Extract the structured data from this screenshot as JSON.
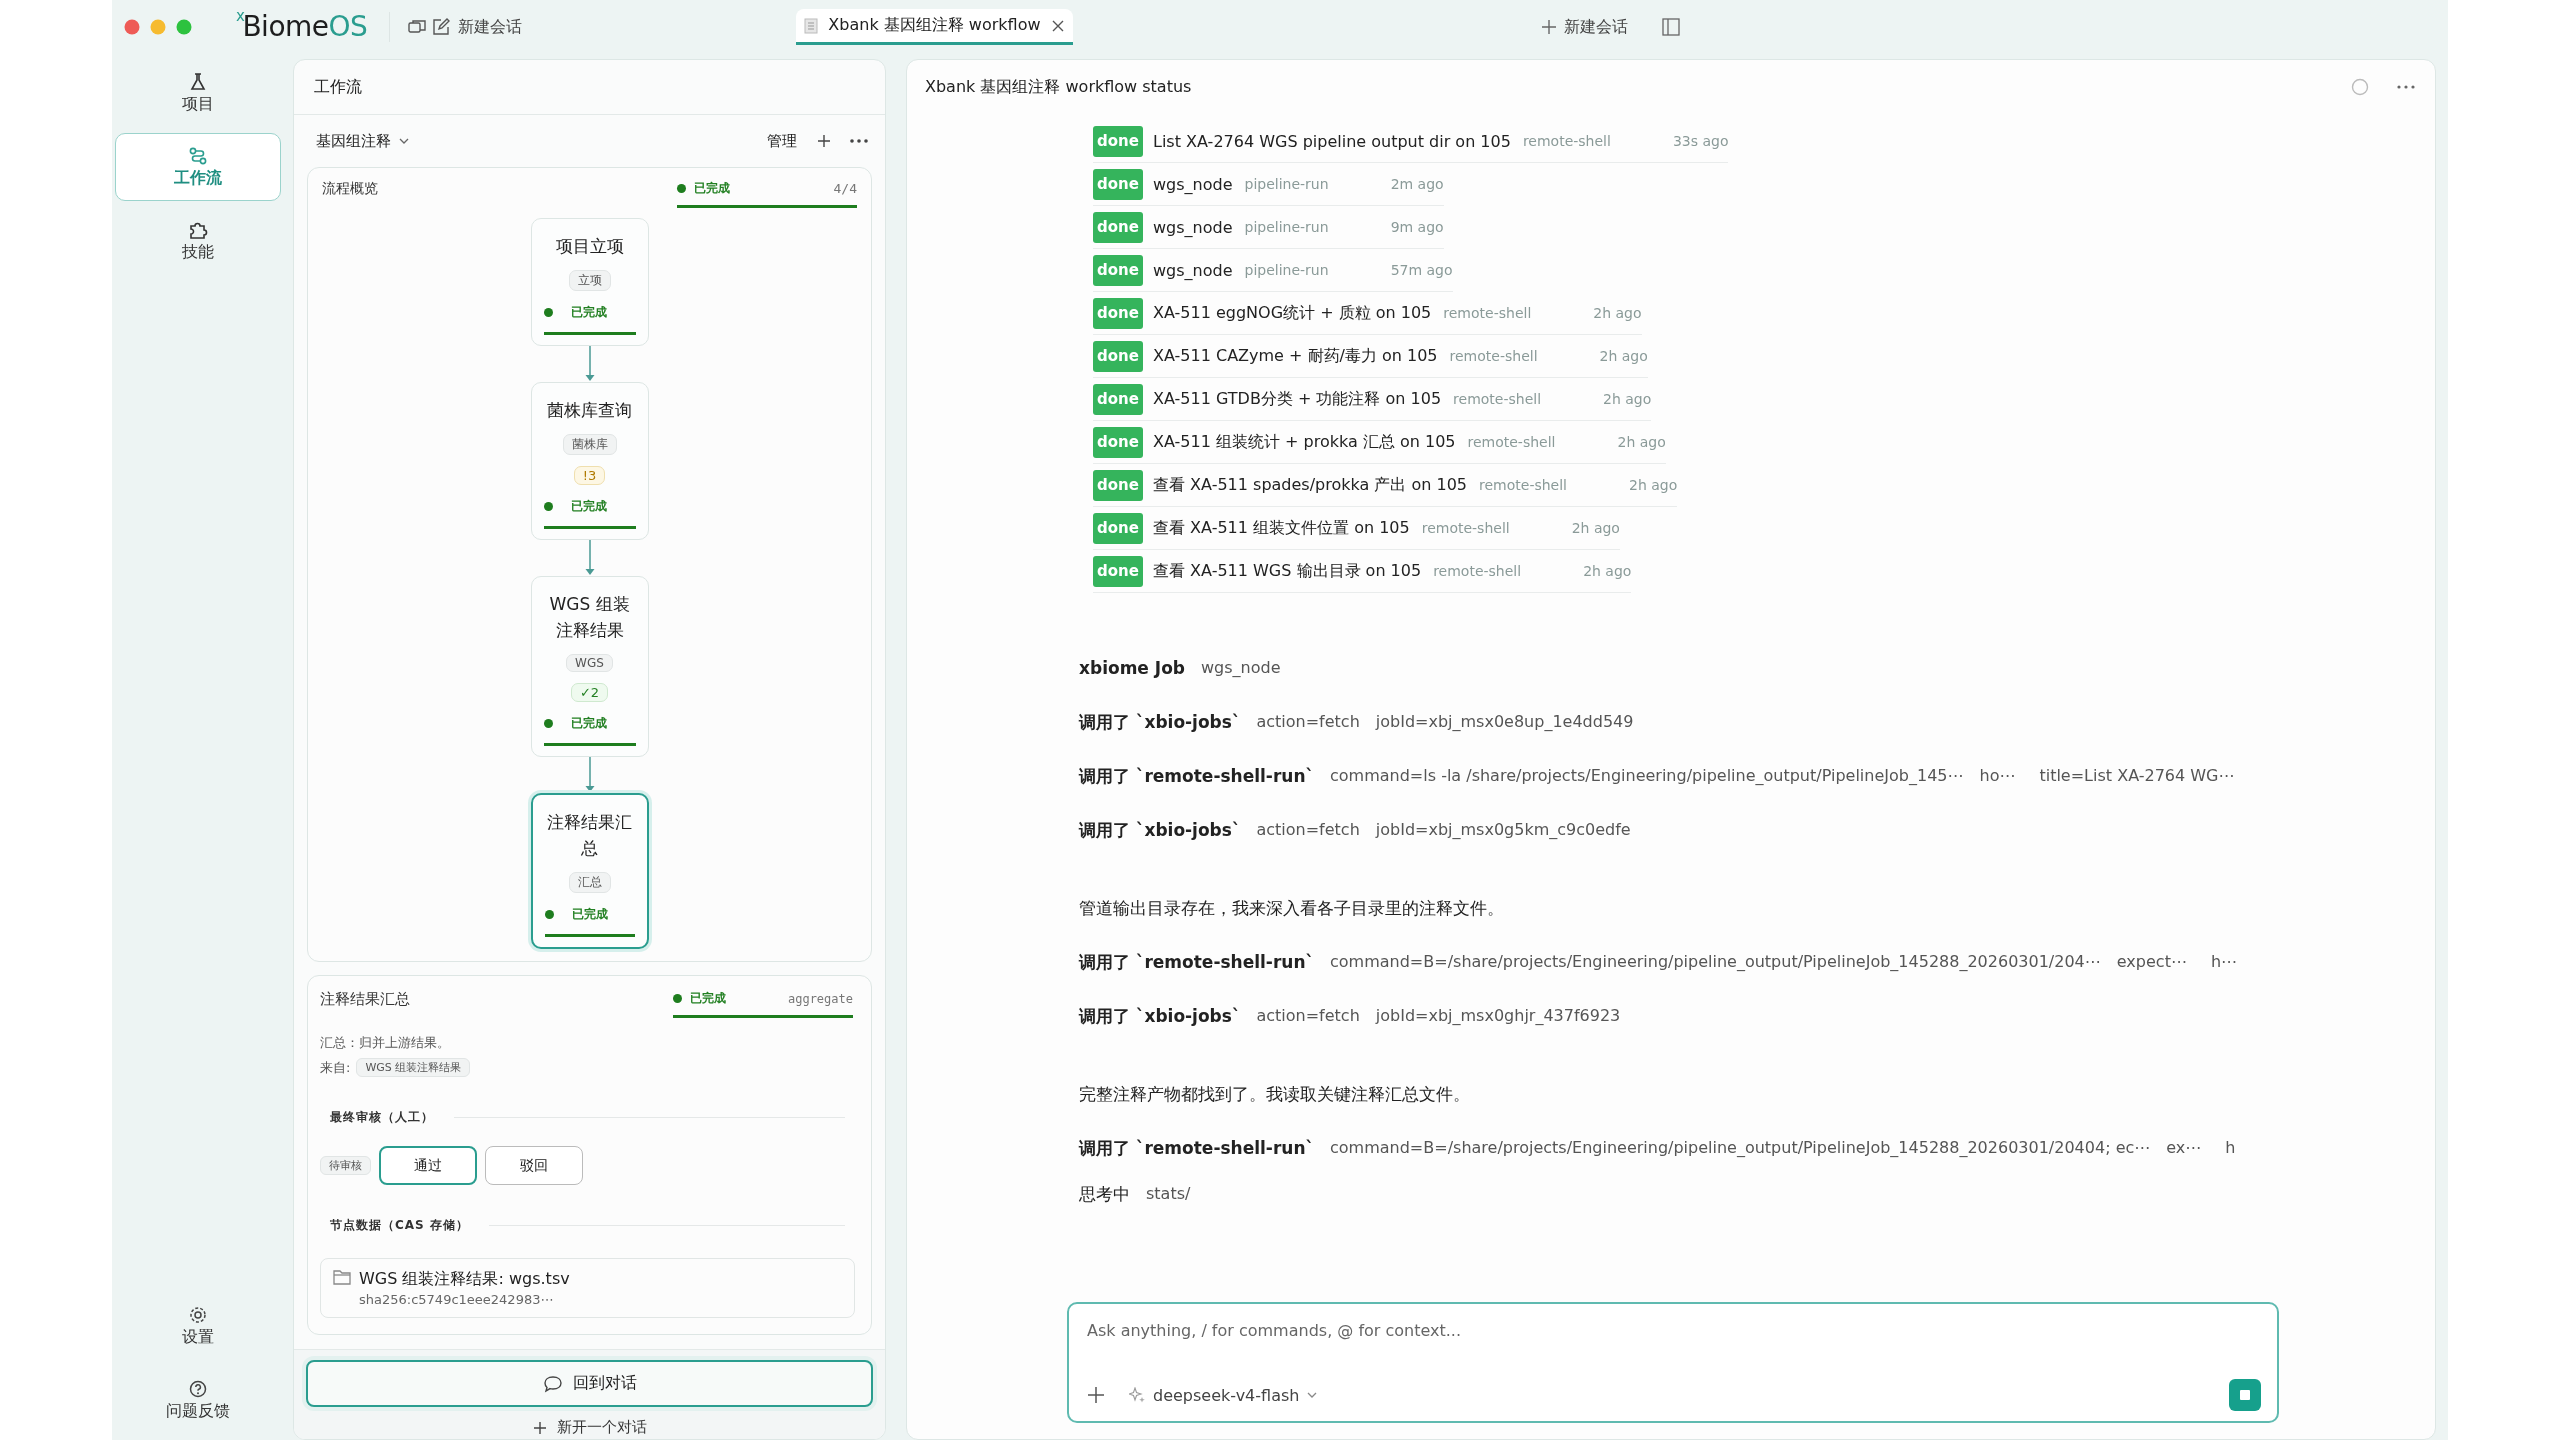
{
  "titlebar": {
    "logo": {
      "main": "Biome",
      "accent": "OS",
      "mark": "x"
    },
    "new_chat": "新建会话",
    "tabs": [
      {
        "label": "Xbank 基因组注释 workflow",
        "selected": true
      }
    ],
    "right_new_chat": "新建会话"
  },
  "nav": {
    "items": [
      {
        "kind": "project",
        "label": "项目",
        "selected": false
      },
      {
        "kind": "workflow",
        "label": "工作流",
        "selected": true
      },
      {
        "kind": "skills",
        "label": "技能",
        "selected": false
      }
    ],
    "bottom": [
      {
        "kind": "settings",
        "label": "设置"
      },
      {
        "kind": "feedback",
        "label": "问题反馈"
      }
    ]
  },
  "workflow": {
    "title": "工作流",
    "selector": "基因组注释",
    "manage": "管理",
    "overview": {
      "title": "流程概览",
      "status": "已完成",
      "count": "4/4",
      "level": 1,
      "nodes": [
        {
          "title": "项目立项",
          "tag": "立项",
          "status": "已完成",
          "level": 1,
          "selected": false
        },
        {
          "title": "菌株库查询",
          "tag": "菌株库",
          "badge": {
            "kind": "warning",
            "text": "!3"
          },
          "status": "已完成",
          "level": 1,
          "selected": false
        },
        {
          "title": "WGS 组装注释结果",
          "tag": "WGS",
          "badge": {
            "kind": "ok",
            "text": "✓2"
          },
          "status": "已完成",
          "level": 1,
          "selected": false
        },
        {
          "title": "注释结果汇总",
          "tag": "汇总",
          "status": "已完成",
          "level": 1,
          "selected": true
        }
      ]
    },
    "detail": {
      "title": "注释结果汇总",
      "status": "已完成",
      "type": "aggregate",
      "level": 1,
      "summary": "汇总：归并上游结果。",
      "from_label": "来自:",
      "from_tag": "WGS 组装注释结果",
      "review_heading": "最终审核（人工）",
      "review_state": "待审核",
      "review_buttons": [
        {
          "label": "通过",
          "selected": true
        },
        {
          "label": "驳回",
          "selected": false
        }
      ],
      "data_heading": "节点数据（CAS 存储）",
      "file": {
        "name": "WGS 组装注释结果: wgs.tsv",
        "hash": "sha256:c5749c1eee242983⋯"
      }
    },
    "back_button": "回到对话",
    "new_chat": "新开一个对话"
  },
  "chat": {
    "title": "Xbank 基因组注释 workflow status",
    "jobs": [
      {
        "status": "done",
        "title": "List XA-2764 WGS pipeline output dir on 105",
        "type": "remote-shell",
        "time": "33s ago"
      },
      {
        "status": "done",
        "title": "wgs_node",
        "type": "pipeline-run",
        "time": "2m ago"
      },
      {
        "status": "done",
        "title": "wgs_node",
        "type": "pipeline-run",
        "time": "9m ago"
      },
      {
        "status": "done",
        "title": "wgs_node",
        "type": "pipeline-run",
        "time": "57m ago"
      },
      {
        "status": "done",
        "title": "XA-511 eggNOG统计 + 质粒 on 105",
        "type": "remote-shell",
        "time": "2h ago"
      },
      {
        "status": "done",
        "title": "XA-511 CAZyme + 耐药/毒力 on 105",
        "type": "remote-shell",
        "time": "2h ago"
      },
      {
        "status": "done",
        "title": "XA-511 GTDB分类 + 功能注释 on 105",
        "type": "remote-shell",
        "time": "2h ago"
      },
      {
        "status": "done",
        "title": "XA-511 组装统计 + prokka 汇总 on 105",
        "type": "remote-shell",
        "time": "2h ago"
      },
      {
        "status": "done",
        "title": "查看 XA-511 spades/prokka 产出 on 105",
        "type": "remote-shell",
        "time": "2h ago"
      },
      {
        "status": "done",
        "title": "查看 XA-511 组装文件位置 on 105",
        "type": "remote-shell",
        "time": "2h ago"
      },
      {
        "status": "done",
        "title": "查看 XA-511 WGS 输出目录 on 105",
        "type": "remote-shell",
        "time": "2h ago"
      }
    ],
    "messages": [
      {
        "kind": "job",
        "label": "xbiome Job",
        "args": [
          "wgs_node"
        ]
      },
      {
        "kind": "tool",
        "label": "调用了 `xbio-jobs`",
        "args": [
          "action=fetch",
          "jobId=xbj_msx0e8up_1e4dd549"
        ]
      },
      {
        "kind": "tool",
        "label": "调用了 `remote-shell-run`",
        "args": [
          "command=ls -la /share/projects/Engineering/pipeline_output/PipelineJob_145⋯",
          "ho⋯",
          "title=List XA-2764 WG⋯"
        ]
      },
      {
        "kind": "tool",
        "label": "调用了 `xbio-jobs`",
        "args": [
          "action=fetch",
          "jobId=xbj_msx0g5km_c9c0edfe"
        ]
      },
      {
        "kind": "text",
        "label": "管道输出目录存在，我来深入看各子目录里的注释文件。"
      },
      {
        "kind": "tool",
        "label": "调用了 `remote-shell-run`",
        "args": [
          "command=B=/share/projects/Engineering/pipeline_output/PipelineJob_145288_20260301/204⋯",
          "expect⋯",
          "h⋯"
        ]
      },
      {
        "kind": "tool",
        "label": "调用了 `xbio-jobs`",
        "args": [
          "action=fetch",
          "jobId=xbj_msx0ghjr_437f6923"
        ]
      },
      {
        "kind": "text",
        "label": "完整注释产物都找到了。我读取关键注释汇总文件。"
      },
      {
        "kind": "tool",
        "label": "调用了 `remote-shell-run`",
        "args": [
          "command=B=/share/projects/Engineering/pipeline_output/PipelineJob_145288_20260301/20404; ec⋯",
          "ex⋯",
          "h"
        ]
      },
      {
        "kind": "thinking",
        "label": "思考中",
        "args": [
          "stats/"
        ]
      }
    ],
    "input": {
      "placeholder": "Ask anything, / for commands, @ for context...",
      "model": "deepseek-v4-flash"
    }
  }
}
